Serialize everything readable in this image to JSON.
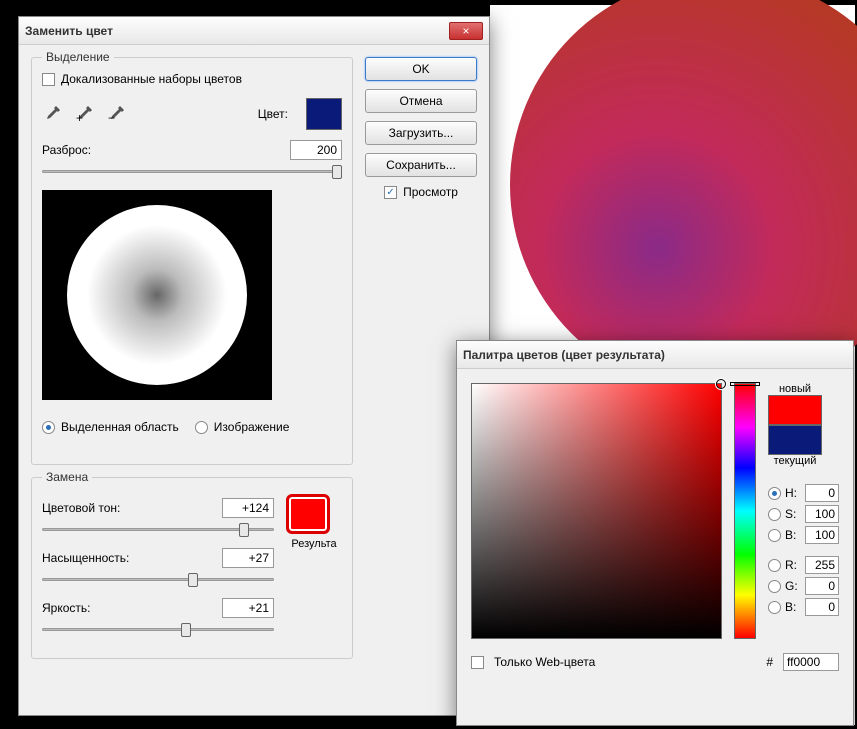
{
  "replace_dialog": {
    "title": "Заменить цвет",
    "selection_group": "Выделение",
    "localized_sets": "Докализованные наборы цветов",
    "color_label": "Цвет:",
    "color_value": "#0a1a78",
    "fuzziness_label": "Разброс:",
    "fuzziness_value": "200",
    "radio_selection": "Выделенная область",
    "radio_image": "Изображение",
    "replace_group": "Замена",
    "hue_label": "Цветовой тон:",
    "hue_value": "+124",
    "saturation_label": "Насыщенность:",
    "saturation_value": "+27",
    "lightness_label": "Яркость:",
    "lightness_value": "+21",
    "result_label": "Результа",
    "result_color": "#ff0000"
  },
  "buttons": {
    "ok": "OK",
    "cancel": "Отмена",
    "load": "Загрузить...",
    "save": "Сохранить...",
    "preview": "Просмотр"
  },
  "picker": {
    "title": "Палитра цветов (цвет результата)",
    "new_label": "новый",
    "current_label": "текущий",
    "new_color": "#ff0000",
    "current_color": "#0a1a78",
    "h_label": "H:",
    "h_value": "0",
    "s_label": "S:",
    "s_value": "100",
    "b_label": "B:",
    "b_value": "100",
    "r_label": "R:",
    "r_value": "255",
    "g_label": "G:",
    "g_value": "0",
    "bb_label": "B:",
    "bb_value": "0",
    "web_only": "Только Web-цвета",
    "hex_prefix": "#",
    "hex_value": "ff0000"
  }
}
